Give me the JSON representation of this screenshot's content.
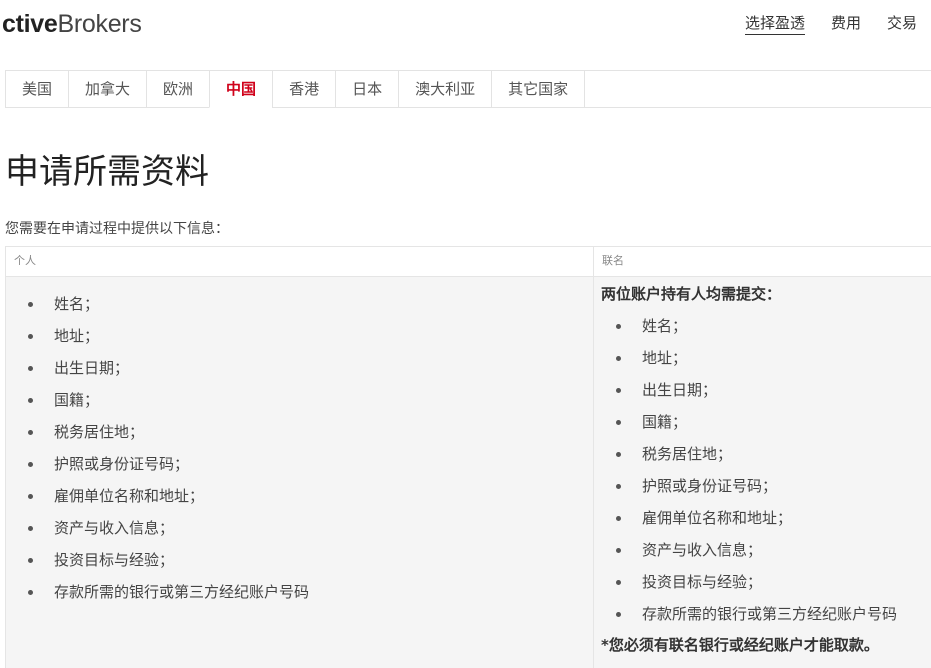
{
  "header": {
    "logo_bold": "ctive",
    "logo_rest": "Brokers",
    "nav": [
      "选择盈透",
      "费用",
      "交易"
    ]
  },
  "tabs": [
    "美国",
    "加拿大",
    "欧洲",
    "中国",
    "香港",
    "日本",
    "澳大利亚",
    "其它国家"
  ],
  "active_tab": "中国",
  "page": {
    "title": "申请所需资料",
    "intro": "您需要在申请过程中提供以下信息："
  },
  "table": {
    "col_individual": "个人",
    "col_joint": "联名",
    "individual_items": [
      "姓名；",
      "地址；",
      "出生日期；",
      "国籍；",
      "税务居住地；",
      "护照或身份证号码；",
      "雇佣单位名称和地址；",
      "资产与收入信息；",
      "投资目标与经验；",
      "存款所需的银行或第三方经纪账户号码"
    ],
    "joint_heading": "两位账户持有人均需提交：",
    "joint_items": [
      "姓名；",
      "地址；",
      "出生日期；",
      "国籍；",
      "税务居住地；",
      "护照或身份证号码；",
      "雇佣单位名称和地址；",
      "资产与收入信息；",
      "投资目标与经验；",
      "存款所需的银行或第三方经纪账户号码"
    ],
    "joint_note": "*您必须有联名银行或经纪账户才能取款。"
  },
  "colors": {
    "active_tab": "#d0021b"
  }
}
